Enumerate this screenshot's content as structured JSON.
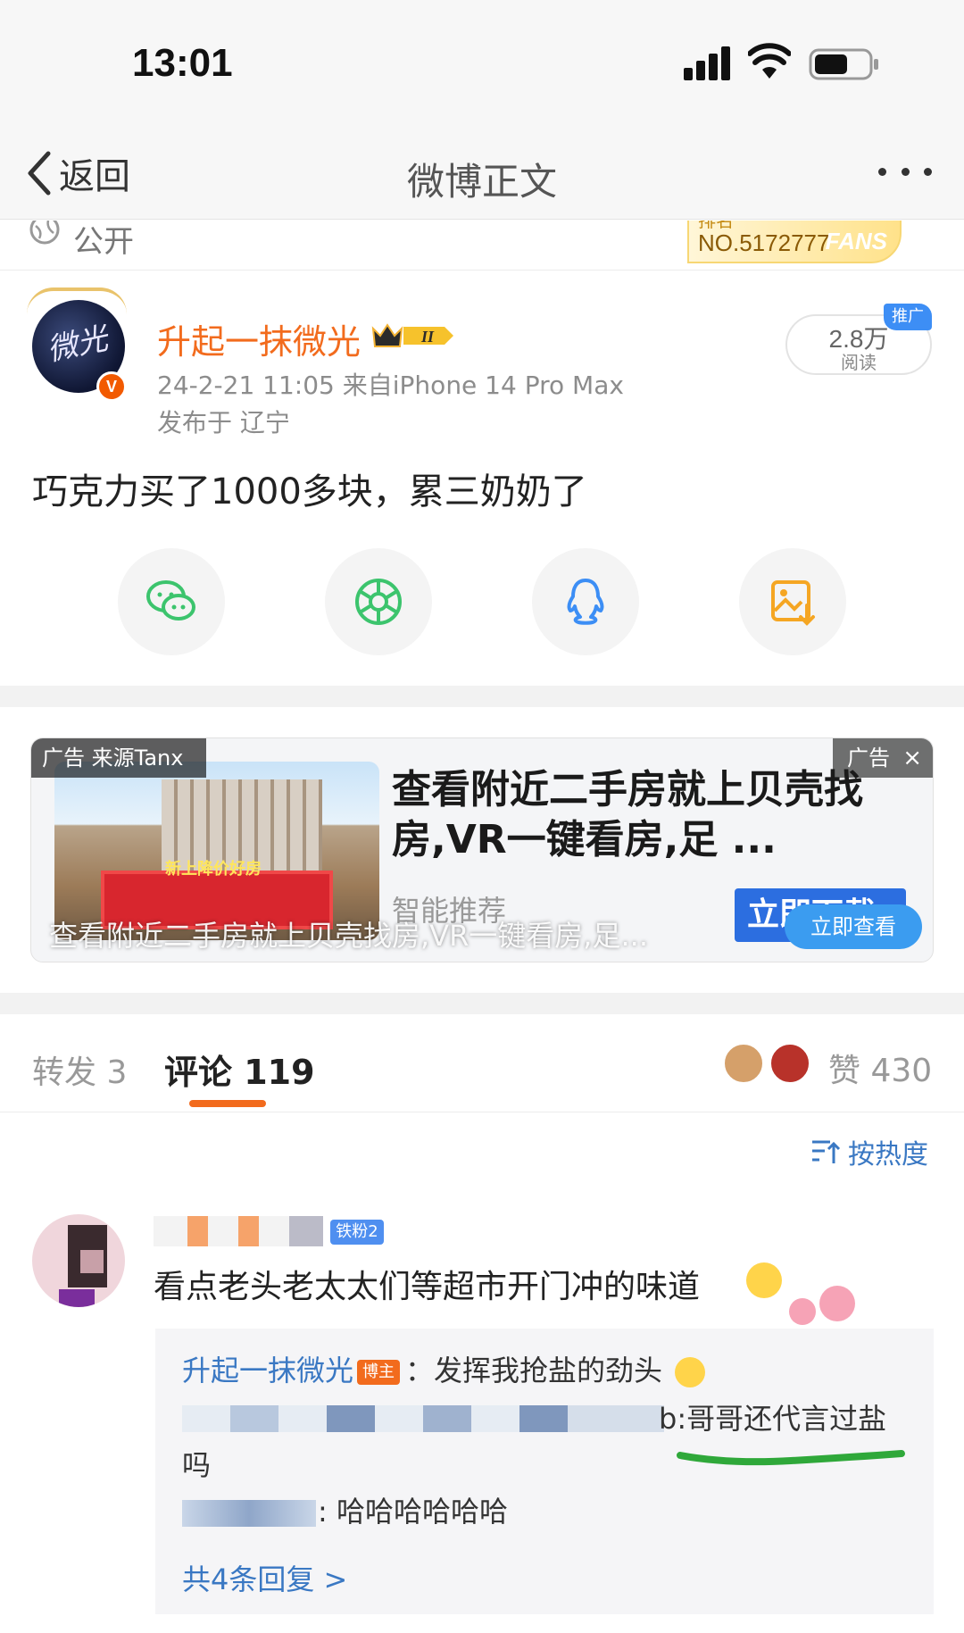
{
  "status_bar": {
    "time": "13:01"
  },
  "nav": {
    "back_label": "返回",
    "title": "微博正文"
  },
  "visibility": {
    "label": "公开",
    "fans_badge_top": "排名",
    "fans_badge_number": "NO.5172777",
    "fans_badge_word": "FANS"
  },
  "post": {
    "author": "升起一抹微光",
    "verified_badge": "V",
    "meta": "24-2-21 11:05  来自iPhone 14 Pro Max",
    "location": "发布于 辽宁",
    "read_count": "2.8万",
    "read_label": "阅读",
    "promo_tag": "推广",
    "text": "巧克力买了1000多块，累三奶奶了"
  },
  "share_buttons": [
    {
      "icon": "wechat-icon",
      "color": "#3cc46d"
    },
    {
      "icon": "moments-icon",
      "color": "#3cc46d"
    },
    {
      "icon": "qq-icon",
      "color": "#3c8ef5"
    },
    {
      "icon": "save-image-icon",
      "color": "#f5a623"
    }
  ],
  "ad": {
    "source": "广告 来源Tanx",
    "tag": "广告",
    "close": "×",
    "image_text": "新上降价好房",
    "headline": "查看附近二手房就上贝壳找房,VR一键看房,足 ...",
    "subtitle": "智能推荐",
    "download_label": "立即下载",
    "overlay_text": "查看附近二手房就上贝壳找房,VR一键看房,足...",
    "view_button": "立即查看"
  },
  "tabs": {
    "repost": "转发 3",
    "comments": "评论 119",
    "likes": "赞 430"
  },
  "sort": {
    "label": "按热度"
  },
  "comment": {
    "fan_badge": "铁粉2",
    "text": "看点老头老太太们等超市开门冲的味道",
    "replies": [
      {
        "name": "升起一抹微光",
        "badge": "博主",
        "text": "：发挥我抢盐的劲头"
      },
      {
        "text": "b:哥哥还代言过盐",
        "continuation": "吗"
      },
      {
        "text": ": 哈哈哈哈哈哈"
      }
    ],
    "more_replies": "共4条回复 >"
  }
}
